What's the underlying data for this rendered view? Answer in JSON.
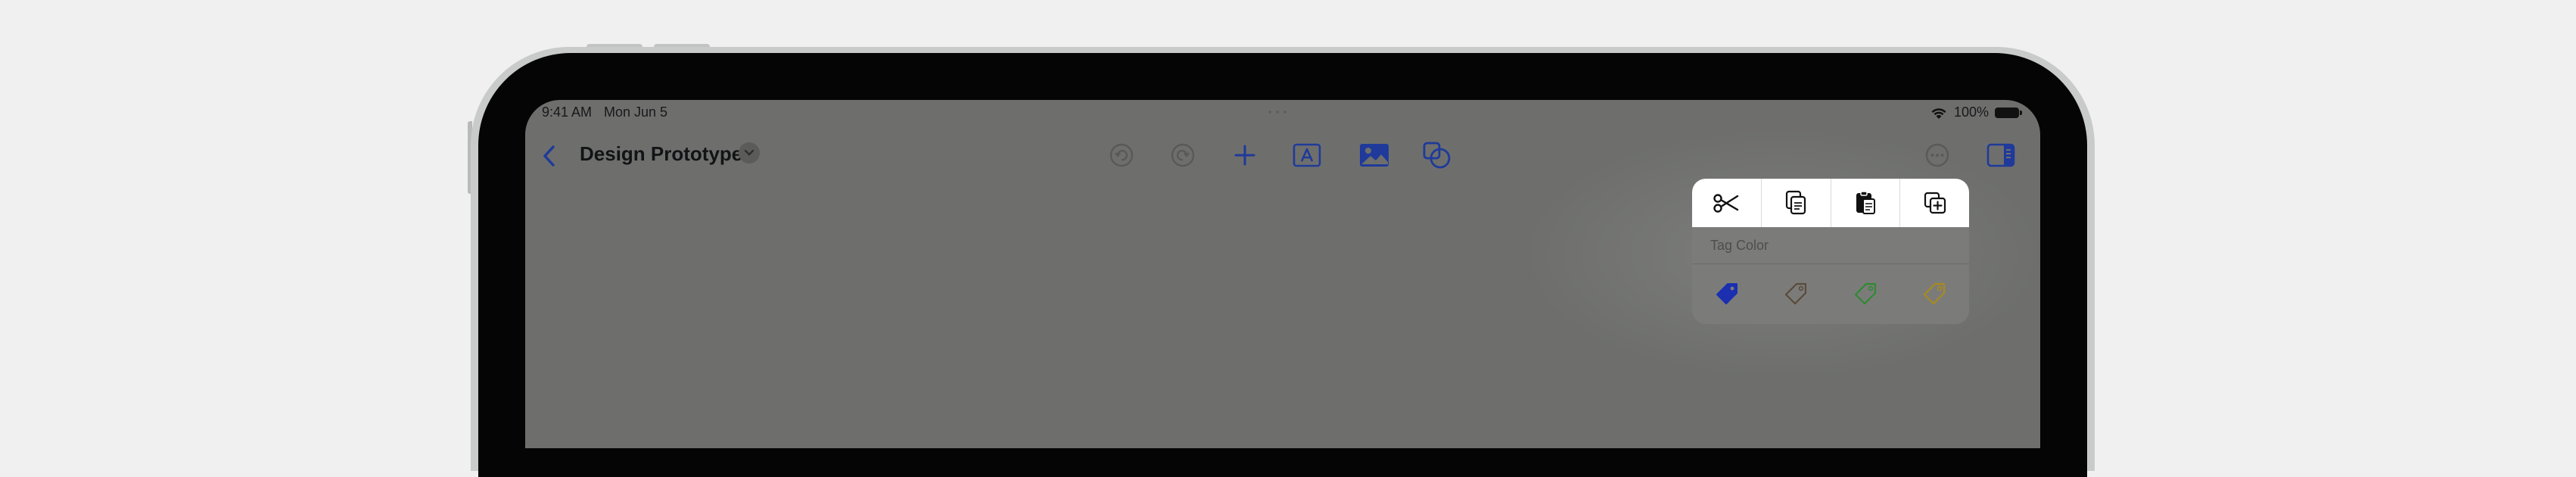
{
  "status_bar": {
    "time": "9:41 AM",
    "date": "Mon Jun 5",
    "battery": "100%"
  },
  "header": {
    "title": "Design Prototype",
    "icons": {
      "back": "chevron-left-icon",
      "title_menu": "chevron-down-icon",
      "undo": "undo-icon",
      "redo": "redo-icon",
      "add": "plus-icon",
      "text": "text-box-icon",
      "image": "image-icon",
      "shapes": "shapes-icon",
      "more": "ellipsis-circle-icon",
      "sidebar": "sidebar-right-icon"
    }
  },
  "context_menu": {
    "actions": [
      {
        "icon": "scissors-icon",
        "action": "cut"
      },
      {
        "icon": "copy-icon",
        "action": "copy"
      },
      {
        "icon": "paste-icon",
        "action": "paste"
      },
      {
        "icon": "duplicate-icon",
        "action": "duplicate"
      }
    ],
    "tag_section_label": "Tag Color",
    "tag_colors": [
      {
        "name": "blue",
        "color": "#1b2fb0"
      },
      {
        "name": "brown",
        "color": "#5a4a3a"
      },
      {
        "name": "green",
        "color": "#2f8a31"
      },
      {
        "name": "yellow",
        "color": "#a88a1e"
      }
    ]
  },
  "colors": {
    "accent": "#1f4fd6",
    "screen_dim": "#6e6f6d",
    "menu_bg": "#ffffff"
  }
}
